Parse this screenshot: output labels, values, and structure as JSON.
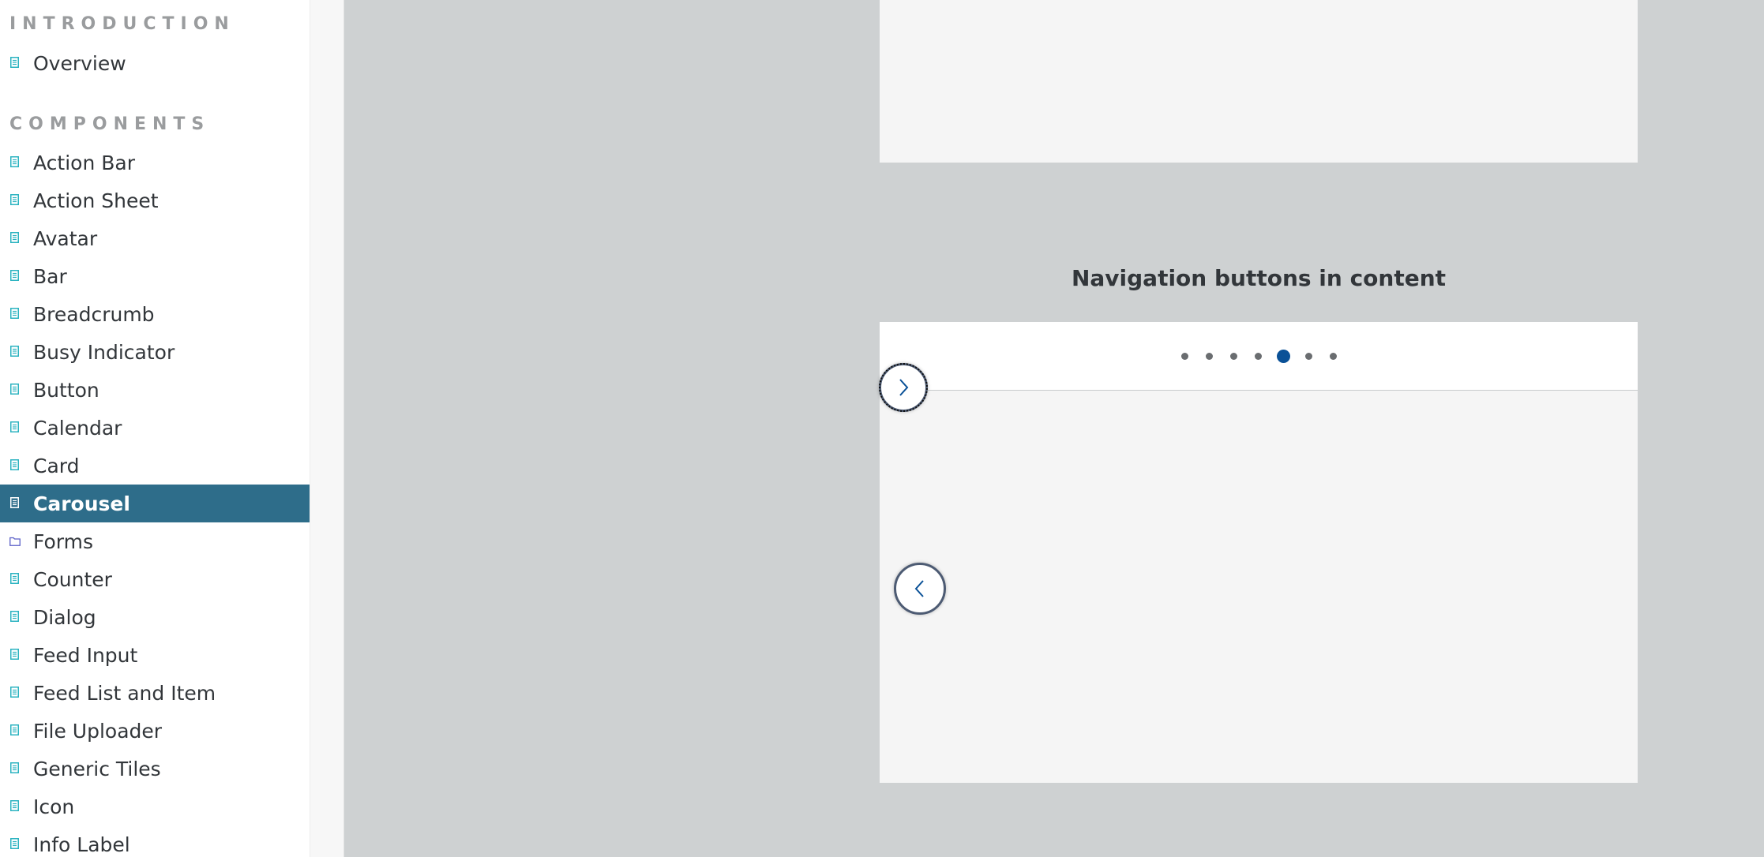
{
  "sidebar": {
    "sections": [
      {
        "heading": "INTRODUCTION"
      },
      {
        "heading": "COMPONENTS"
      }
    ],
    "items": [
      {
        "label": "Overview",
        "icon": "document-icon"
      },
      {
        "label": "Action Bar",
        "icon": "document-icon"
      },
      {
        "label": "Action Sheet",
        "icon": "document-icon"
      },
      {
        "label": "Avatar",
        "icon": "document-icon"
      },
      {
        "label": "Bar",
        "icon": "document-icon"
      },
      {
        "label": "Breadcrumb",
        "icon": "document-icon"
      },
      {
        "label": "Busy Indicator",
        "icon": "document-icon"
      },
      {
        "label": "Button",
        "icon": "document-icon"
      },
      {
        "label": "Calendar",
        "icon": "document-icon"
      },
      {
        "label": "Card",
        "icon": "document-icon"
      },
      {
        "label": "Carousel",
        "icon": "document-icon",
        "active": true
      },
      {
        "label": "Forms",
        "icon": "folder-icon"
      },
      {
        "label": "Counter",
        "icon": "document-icon"
      },
      {
        "label": "Dialog",
        "icon": "document-icon"
      },
      {
        "label": "Feed Input",
        "icon": "document-icon"
      },
      {
        "label": "Feed List and Item",
        "icon": "document-icon"
      },
      {
        "label": "File Uploader",
        "icon": "document-icon"
      },
      {
        "label": "Generic Tiles",
        "icon": "document-icon"
      },
      {
        "label": "Icon",
        "icon": "document-icon"
      },
      {
        "label": "Info Label",
        "icon": "document-icon"
      }
    ]
  },
  "main": {
    "section_title": "Navigation buttons in content",
    "carousel": {
      "page_count": 7,
      "active_page": 5,
      "next_icon": "chevron-right-icon",
      "prev_icon": "chevron-left-icon"
    }
  },
  "colors": {
    "active_nav_bg": "#2e6d8a",
    "page_bg": "#ced1d2",
    "active_dot": "#0a5197",
    "doc_icon": "#2bb3c0",
    "folder_icon": "#5b5fc7"
  }
}
